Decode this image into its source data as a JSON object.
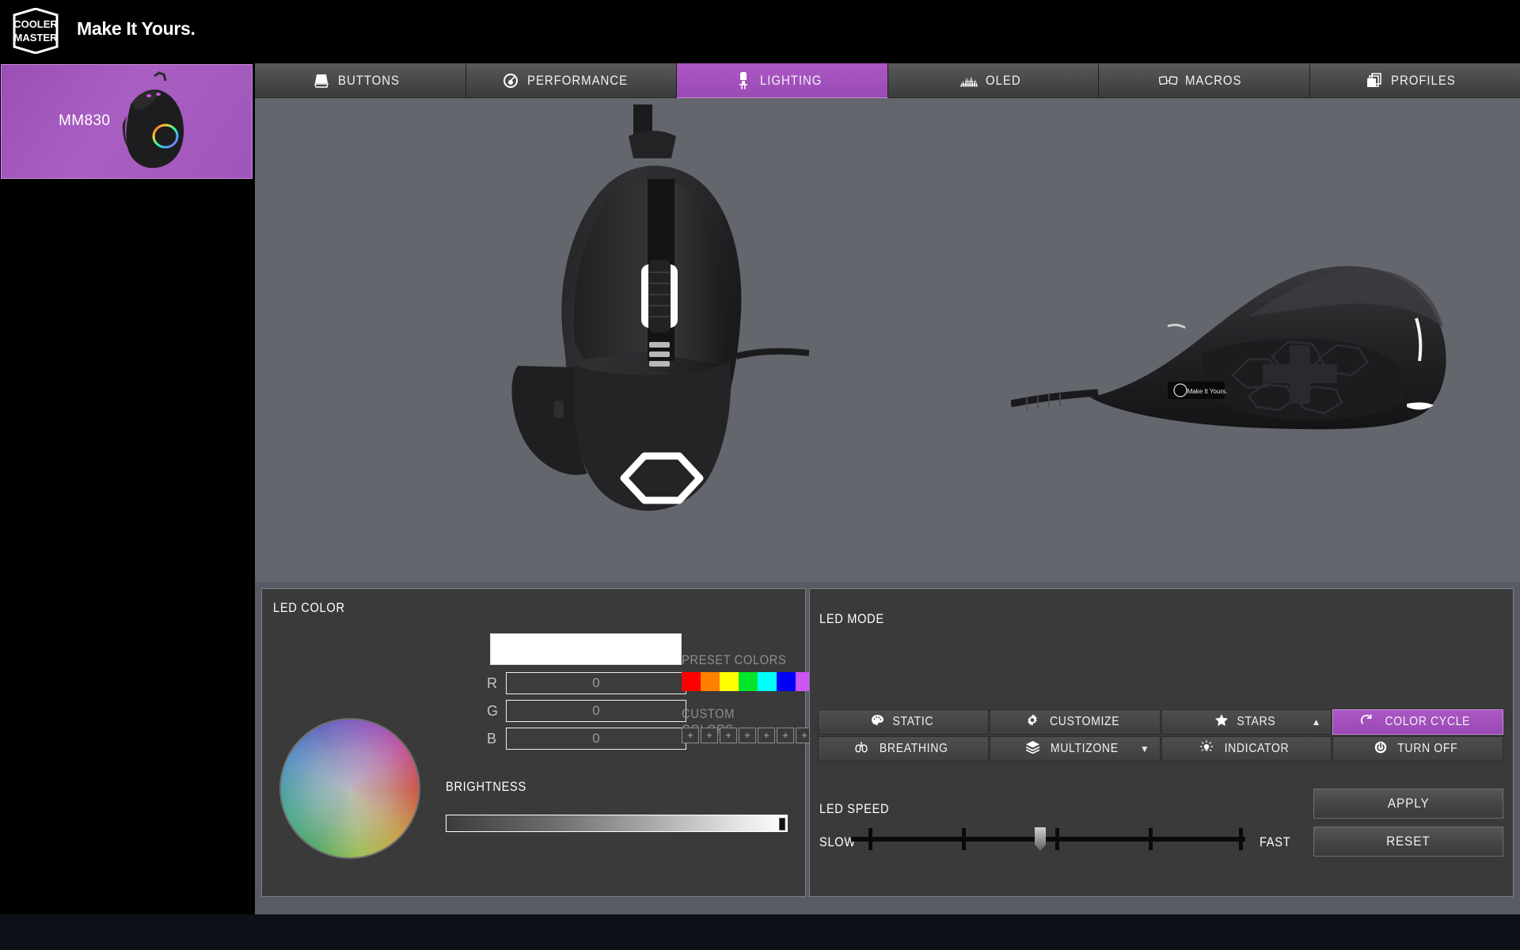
{
  "app": {
    "brand": "COOLER MASTER",
    "tagline": "Make It Yours."
  },
  "sidebar": {
    "devices": [
      {
        "name": "MM830",
        "icon": "mouse-thumb",
        "selected": true
      }
    ]
  },
  "tabs": [
    {
      "id": "buttons",
      "label": "BUTTONS",
      "icon": "mouse-icon",
      "active": false
    },
    {
      "id": "performance",
      "label": "PERFORMANCE",
      "icon": "speedometer-icon",
      "active": false
    },
    {
      "id": "lighting",
      "label": "LIGHTING",
      "icon": "led-bulb-icon",
      "active": true
    },
    {
      "id": "oled",
      "label": "OLED",
      "icon": "waveform-icon",
      "active": false
    },
    {
      "id": "macros",
      "label": "MACROS",
      "icon": "keys-icon",
      "active": false
    },
    {
      "id": "profiles",
      "label": "PROFILES",
      "icon": "layers-icon",
      "active": false
    }
  ],
  "preview": {
    "top_view_alt": "MM830 mouse top view",
    "side_view_alt": "MM830 mouse side view",
    "side_oled_text": "Make It Yours."
  },
  "led_color": {
    "title": "LED COLOR",
    "swatch_hex": "#ffffff",
    "channels": [
      {
        "label": "R",
        "value": "0"
      },
      {
        "label": "G",
        "value": "0"
      },
      {
        "label": "B",
        "value": "0"
      }
    ],
    "preset_label": "PRESET COLORS",
    "preset_colors": [
      "#ff0000",
      "#ff8000",
      "#ffff00",
      "#00e52b",
      "#00ffff",
      "#0000f5",
      "#cc55f5"
    ],
    "custom_label": "CUSTOM COLORS",
    "custom_slots": [
      "+",
      "+",
      "+",
      "+",
      "+",
      "+",
      "+"
    ],
    "brightness_label": "BRIGHTNESS",
    "brightness_value": 100
  },
  "led_mode": {
    "title": "LED MODE",
    "modes": [
      {
        "id": "static",
        "label": "STATIC",
        "icon": "palette-icon",
        "active": false,
        "caret": ""
      },
      {
        "id": "customize",
        "label": "CUSTOMIZE",
        "icon": "gear-icon",
        "active": false,
        "caret": ""
      },
      {
        "id": "stars",
        "label": "STARS",
        "icon": "star-icon",
        "active": false,
        "caret": "▲"
      },
      {
        "id": "colorcycle",
        "label": "COLOR CYCLE",
        "icon": "refresh-icon",
        "active": true,
        "caret": ""
      },
      {
        "id": "breathing",
        "label": "BREATHING",
        "icon": "lungs-icon",
        "active": false,
        "caret": ""
      },
      {
        "id": "multizone",
        "label": "MULTIZONE",
        "icon": "layers-icon",
        "active": false,
        "caret": "▼"
      },
      {
        "id": "indicator",
        "label": "INDICATOR",
        "icon": "lightbulb-icon",
        "active": false,
        "caret": ""
      },
      {
        "id": "turnoff",
        "label": "TURN OFF",
        "icon": "power-icon",
        "active": false,
        "caret": ""
      }
    ],
    "speed_label": "LED SPEED",
    "speed_min_label": "SLOW",
    "speed_max_label": "FAST",
    "speed_value": 50,
    "apply_label": "APPLY",
    "reset_label": "RESET"
  },
  "colors": {
    "accent_purple": "#a14fbb",
    "panel_bg": "#3a3a3a",
    "stage_bg": "#63666d",
    "lower_bg": "#585b63",
    "header_bg": "#000000"
  }
}
